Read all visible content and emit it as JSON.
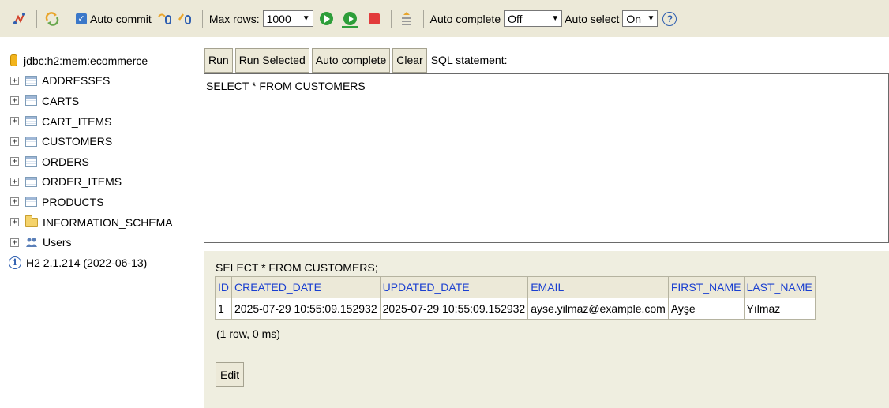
{
  "toolbar": {
    "auto_commit_label": "Auto commit",
    "max_rows_label": "Max rows:",
    "max_rows_value": "1000",
    "auto_complete_label": "Auto complete",
    "auto_complete_value": "Off",
    "auto_select_label": "Auto select",
    "auto_select_value": "On",
    "help_glyph": "?"
  },
  "tree": {
    "connection": "jdbc:h2:mem:ecommerce",
    "tables": [
      "ADDRESSES",
      "CARTS",
      "CART_ITEMS",
      "CUSTOMERS",
      "ORDERS",
      "ORDER_ITEMS",
      "PRODUCTS"
    ],
    "schema": "INFORMATION_SCHEMA",
    "users": "Users",
    "version": "H2 2.1.214 (2022-06-13)"
  },
  "query": {
    "run": "Run",
    "run_selected": "Run Selected",
    "auto_complete": "Auto complete",
    "clear": "Clear",
    "label": "SQL statement:",
    "sql": "SELECT * FROM CUSTOMERS"
  },
  "results": {
    "query": "SELECT * FROM CUSTOMERS;",
    "columns": [
      "ID",
      "CREATED_DATE",
      "UPDATED_DATE",
      "EMAIL",
      "FIRST_NAME",
      "LAST_NAME"
    ],
    "rows": [
      [
        "1",
        "2025-07-29 10:55:09.152932",
        "2025-07-29 10:55:09.152932",
        "ayse.yilmaz@example.com",
        "Ayşe",
        "Yılmaz"
      ]
    ],
    "info": "(1 row, 0 ms)",
    "edit": "Edit"
  }
}
